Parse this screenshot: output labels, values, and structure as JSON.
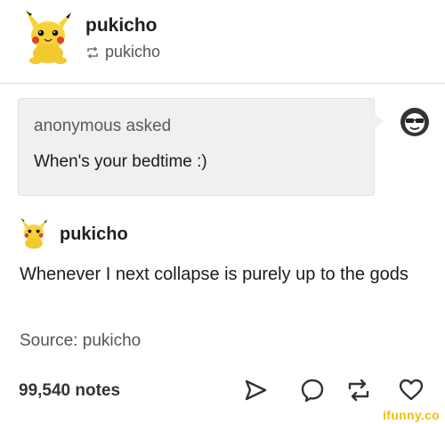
{
  "header": {
    "blog_name": "pukicho",
    "reblogged_from": "pukicho"
  },
  "ask": {
    "asker_label": "anonymous asked",
    "question": "When's your bedtime :)"
  },
  "answer": {
    "blog_name": "pukicho",
    "text": "Whenever I next collapse is purely up to the gods",
    "source": "Source: pukicho"
  },
  "footer": {
    "notes": "99,540 notes",
    "icons": [
      "share-icon",
      "reply-icon",
      "reblog-icon",
      "like-icon"
    ]
  },
  "watermark": "ifunny.co",
  "colors": {
    "ask_bg": "#f0f0f0",
    "pikachu_yellow": "#f7d33a",
    "watermark": "#f2c00a"
  }
}
